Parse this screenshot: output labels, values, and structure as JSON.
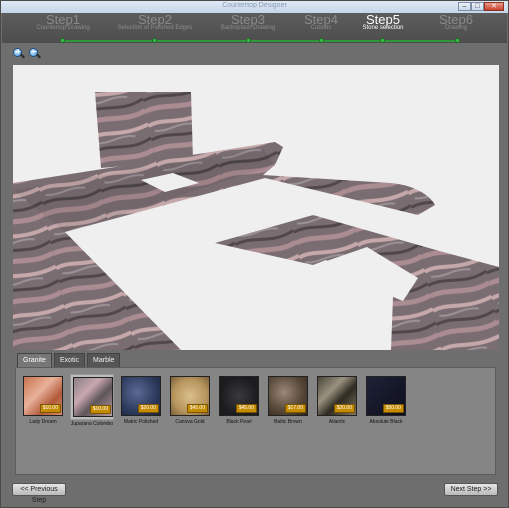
{
  "window": {
    "title": "Countertop Designer"
  },
  "steps": [
    {
      "label": "Step1",
      "sub": "Countertop Drawing"
    },
    {
      "label": "Step2",
      "sub": "Selection of Polished Edges"
    },
    {
      "label": "Step3",
      "sub": "Backsplash Drawing"
    },
    {
      "label": "Step4",
      "sub": "Cutouts"
    },
    {
      "label": "Step5",
      "sub": "Stone selection",
      "active": true
    },
    {
      "label": "Step6",
      "sub": "Drawing"
    }
  ],
  "toolbar": {
    "zoom_in_icon": "zoom-in-icon",
    "zoom_out_icon": "zoom-out-icon"
  },
  "tabs": [
    {
      "label": "Granite",
      "active": true
    },
    {
      "label": "Exotic"
    },
    {
      "label": "Marble"
    }
  ],
  "stones": [
    {
      "name": "Lady Dream",
      "price": "$10.00",
      "color": "#c8734e",
      "accent": "#e9b19a"
    },
    {
      "name": "Juparana Colombo",
      "price": "$10.00",
      "color": "#8c7e84",
      "accent": "#c9a8b0",
      "selected": true
    },
    {
      "name": "Matric Polished",
      "price": "$20.00",
      "color": "#2c3a5c",
      "accent": "#5a6a94"
    },
    {
      "name": "Canova Gold",
      "price": "$45.00",
      "color": "#b8965e",
      "accent": "#d9bf8c"
    },
    {
      "name": "Black Pearl",
      "price": "$45.00",
      "color": "#1c1c1e",
      "accent": "#3a3a3e"
    },
    {
      "name": "Baltic Brown",
      "price": "$17.00",
      "color": "#5a4a3a",
      "accent": "#9a8878"
    },
    {
      "name": "Atlantic",
      "price": "$20.00",
      "color": "#4a4538",
      "accent": "#9a9280"
    },
    {
      "name": "Absolute Black",
      "price": "$50.00",
      "color": "#0e0f1e",
      "accent": "#1e2236"
    }
  ],
  "buttons": {
    "previous": "<< Previous Step",
    "next": "Next Step >>"
  },
  "colors": {
    "progress": "#2e9a3a",
    "price_badge": "#c48a00",
    "granite_base": "#7a6d72",
    "granite_vein": "#d8b6b6"
  }
}
